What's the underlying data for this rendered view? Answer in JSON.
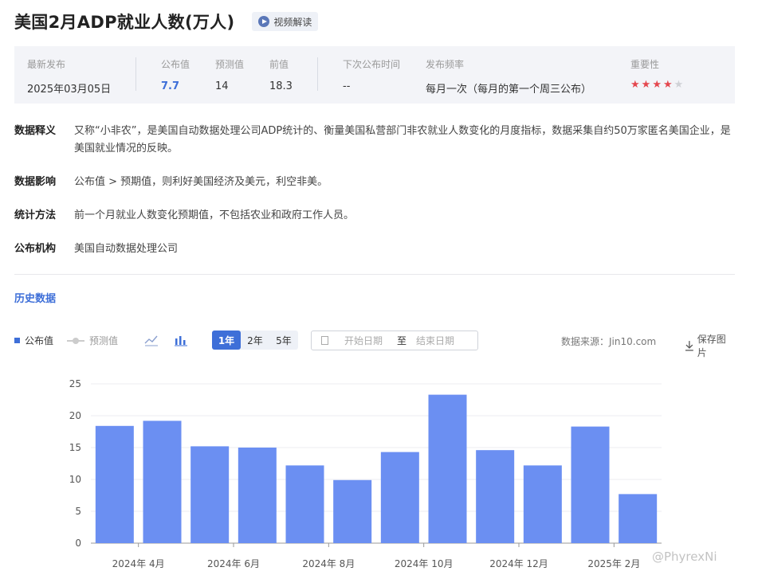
{
  "header": {
    "title": "美国2月ADP就业人数(万人)",
    "video_label": "视频解读"
  },
  "info": {
    "latest_label": "最新发布",
    "latest_value": "2025年03月05日",
    "actual_label": "公布值",
    "actual_value": "7.7",
    "forecast_label": "预测值",
    "forecast_value": "14",
    "previous_label": "前值",
    "previous_value": "18.3",
    "next_label": "下次公布时间",
    "next_value": "--",
    "freq_label": "发布频率",
    "freq_value": "每月一次（每月的第一个周三公布）",
    "importance_label": "重要性",
    "importance_stars": 4,
    "importance_max": 5
  },
  "desc": {
    "def_key": "数据释义",
    "def_val": "又称“小非农”，是美国自动数据处理公司ADP统计的、衡量美国私营部门非农就业人数变化的月度指标，数据采集自约50万家匿名美国企业，是美国就业情况的反映。",
    "impact_key": "数据影响",
    "impact_val": "公布值 > 预期值，则利好美国经济及美元，利空非美。",
    "method_key": "统计方法",
    "method_val": "前一个月就业人数变化预期值，不包括农业和政府工作人员。",
    "org_key": "公布机构",
    "org_val": "美国自动数据处理公司"
  },
  "history": {
    "title": "历史数据"
  },
  "toolbar": {
    "legend_actual": "公布值",
    "legend_forecast": "预测值",
    "ranges": [
      "1年",
      "2年",
      "5年"
    ],
    "active_range": "1年",
    "start_placeholder": "开始日期",
    "date_sep": "至",
    "end_placeholder": "结束日期",
    "source": "数据来源：Jin10.com",
    "save_label": "保存图片",
    "colors": {
      "accent": "#3e6fd8",
      "bar": "#6b8ff2",
      "star": "#e4474e"
    }
  },
  "chart_data": {
    "type": "bar",
    "series": [
      {
        "name": "公布值",
        "values": [
          18.4,
          19.2,
          15.2,
          15.0,
          12.2,
          9.9,
          14.3,
          23.3,
          14.6,
          12.2,
          18.3,
          7.7
        ]
      }
    ],
    "x_tick_labels": [
      "2024年 4月",
      "2024年 6月",
      "2024年 8月",
      "2024年 10月",
      "2024年 12月",
      "2025年 2月"
    ],
    "x_tick_positions": [
      1,
      3,
      5,
      7,
      9,
      11
    ],
    "ylim": [
      0,
      25
    ],
    "yticks": [
      0,
      5,
      10,
      15,
      20,
      25
    ],
    "grid": true
  },
  "watermark": "@PhyrexNi"
}
